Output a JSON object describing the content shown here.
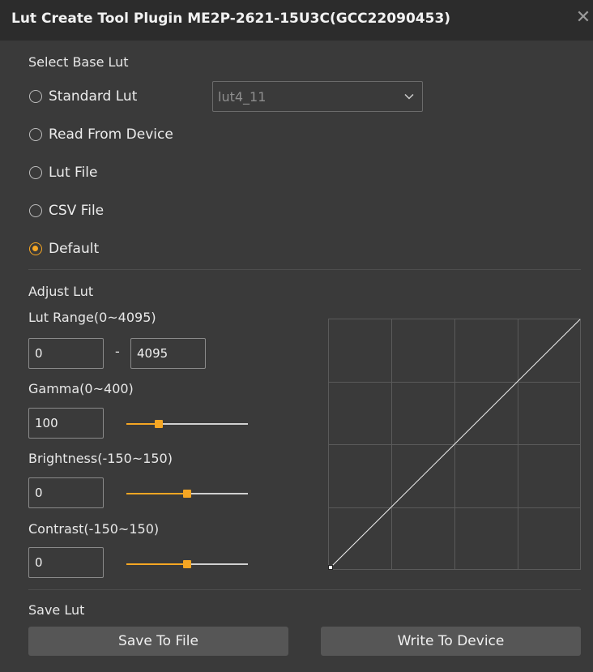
{
  "window": {
    "title": "Lut Create Tool Plugin  ME2P-2621-15U3C(GCC22090453)",
    "close_glyph": "✕"
  },
  "base_lut": {
    "section_label": "Select Base Lut",
    "options": [
      {
        "label": "Standard Lut",
        "checked": false
      },
      {
        "label": "Read From Device",
        "checked": false
      },
      {
        "label": "Lut File",
        "checked": false
      },
      {
        "label": "CSV File",
        "checked": false
      },
      {
        "label": "Default",
        "checked": true
      }
    ],
    "standard_lut_select": {
      "value": "lut4_11",
      "icon": "chevron-down-icon"
    }
  },
  "adjust_lut": {
    "section_label": "Adjust Lut",
    "range": {
      "label": "Lut Range(0~4095)",
      "min": "0",
      "separator": "-",
      "max": "4095"
    },
    "gamma": {
      "label": "Gamma(0~400)",
      "value": "100",
      "level": 0.25
    },
    "brightness": {
      "label": "Brightness(-150~150)",
      "value": "0",
      "level": 0.5
    },
    "contrast": {
      "label": "Contrast(-150~150)",
      "value": "0",
      "level": 0.5
    },
    "curve_grid": {
      "divisions": 4,
      "line": [
        [
          0,
          0
        ],
        [
          4095,
          4095
        ]
      ]
    }
  },
  "save_lut": {
    "section_label": "Save Lut",
    "save_to_file_label": "Save To File",
    "write_to_device_label": "Write To Device"
  },
  "colors": {
    "accent": "#f5a623",
    "background": "#3a3a3a",
    "titlebar": "#2c2c2c",
    "button": "#565656"
  }
}
